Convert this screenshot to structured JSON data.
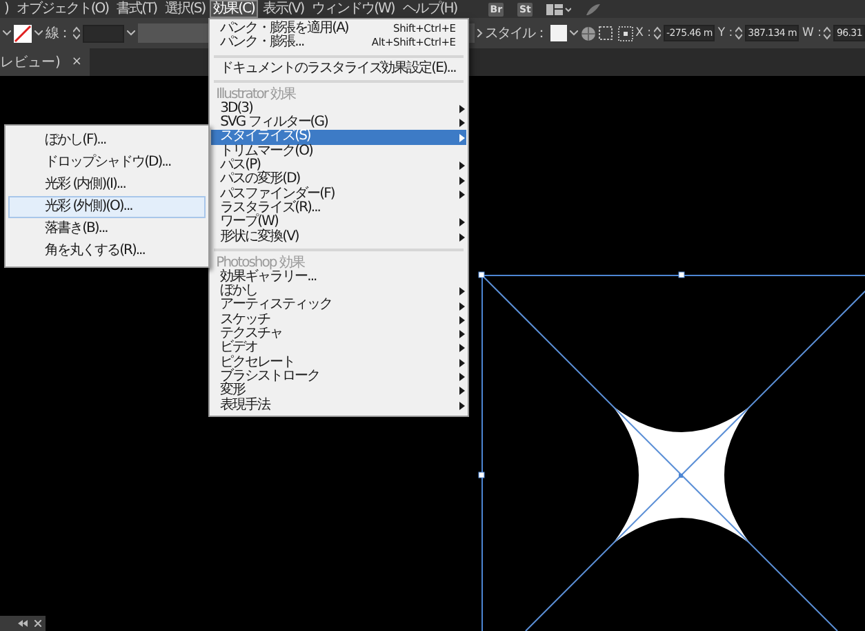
{
  "menubar": {
    "items": [
      {
        "label": ")",
        "selected": false
      },
      {
        "label": "オブジェクト(O)",
        "selected": false
      },
      {
        "label": "書式(T)",
        "selected": false
      },
      {
        "label": "選択(S)",
        "selected": false
      },
      {
        "label": "効果(C)",
        "selected": true
      },
      {
        "label": "表示(V)",
        "selected": false
      },
      {
        "label": "ウィンドウ(W)",
        "selected": false
      },
      {
        "label": "ヘルプ(H)",
        "selected": false
      }
    ],
    "app_buttons": [
      "Br",
      "St"
    ]
  },
  "toolbar": {
    "stroke_label": "線：",
    "style_label": "スタイル：",
    "coordinates": [
      {
        "label": "X :",
        "value": "-275.46 m"
      },
      {
        "label": "Y :",
        "value": "387.134 m"
      },
      {
        "label": "W :",
        "value": "96.31"
      }
    ]
  },
  "document_tab": {
    "title": "レビュー)",
    "close": "×"
  },
  "effect_menu": {
    "items": [
      {
        "kind": "item",
        "label": "パンク・膨張を適用(A)",
        "shortcut": "Shift+Ctrl+E",
        "submenu": false,
        "selected": false
      },
      {
        "kind": "item",
        "label": "パンク・膨張...",
        "shortcut": "Alt+Shift+Ctrl+E",
        "submenu": false,
        "selected": false
      },
      {
        "kind": "separator"
      },
      {
        "kind": "item",
        "label": "ドキュメントのラスタライズ効果設定(E)...",
        "submenu": false,
        "selected": false
      },
      {
        "kind": "separator"
      },
      {
        "kind": "header",
        "label": "Illustrator 効果"
      },
      {
        "kind": "item",
        "label": "3D(3)",
        "submenu": true,
        "selected": false
      },
      {
        "kind": "item",
        "label": "SVG フィルター(G)",
        "submenu": true,
        "selected": false
      },
      {
        "kind": "item",
        "label": "スタイライズ(S)",
        "submenu": true,
        "selected": true
      },
      {
        "kind": "item",
        "label": "トリムマーク(O)",
        "submenu": false,
        "selected": false
      },
      {
        "kind": "item",
        "label": "パス(P)",
        "submenu": true,
        "selected": false
      },
      {
        "kind": "item",
        "label": "パスの変形(D)",
        "submenu": true,
        "selected": false
      },
      {
        "kind": "item",
        "label": "パスファインダー(F)",
        "submenu": true,
        "selected": false
      },
      {
        "kind": "item",
        "label": "ラスタライズ(R)...",
        "submenu": false,
        "selected": false
      },
      {
        "kind": "item",
        "label": "ワープ(W)",
        "submenu": true,
        "selected": false
      },
      {
        "kind": "item",
        "label": "形状に変換(V)",
        "submenu": true,
        "selected": false
      },
      {
        "kind": "separator"
      },
      {
        "kind": "header",
        "label": "Photoshop 効果"
      },
      {
        "kind": "item",
        "label": "効果ギャラリー...",
        "submenu": false,
        "selected": false
      },
      {
        "kind": "item",
        "label": "ぼかし",
        "submenu": true,
        "selected": false
      },
      {
        "kind": "item",
        "label": "アーティスティック",
        "submenu": true,
        "selected": false
      },
      {
        "kind": "item",
        "label": "スケッチ",
        "submenu": true,
        "selected": false
      },
      {
        "kind": "item",
        "label": "テクスチャ",
        "submenu": true,
        "selected": false
      },
      {
        "kind": "item",
        "label": "ビデオ",
        "submenu": true,
        "selected": false
      },
      {
        "kind": "item",
        "label": "ピクセレート",
        "submenu": true,
        "selected": false
      },
      {
        "kind": "item",
        "label": "ブラシストローク",
        "submenu": true,
        "selected": false
      },
      {
        "kind": "item",
        "label": "変形",
        "submenu": true,
        "selected": false
      },
      {
        "kind": "item",
        "label": "表現手法",
        "submenu": true,
        "selected": false
      }
    ]
  },
  "stylize_submenu": {
    "items": [
      {
        "label": "ぼかし(F)...",
        "selected": false
      },
      {
        "label": "ドロップシャドウ(D)...",
        "selected": false
      },
      {
        "label": "光彩 (内側)(I)...",
        "selected": false
      },
      {
        "label": "光彩 (外側)(O)...",
        "selected": true
      },
      {
        "label": "落書き(B)...",
        "selected": false
      },
      {
        "label": "角を丸くする(R)...",
        "selected": false
      }
    ]
  }
}
